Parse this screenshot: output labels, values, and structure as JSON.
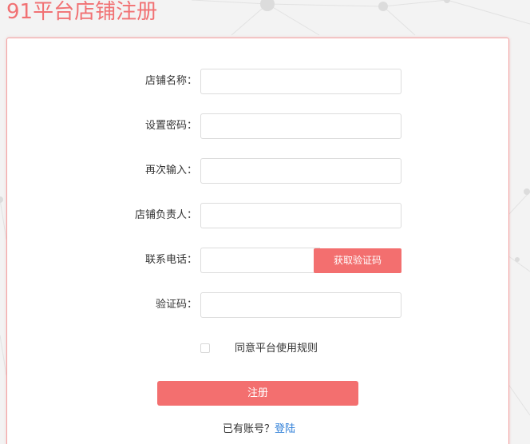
{
  "page": {
    "title": "91平台店铺注册"
  },
  "form": {
    "fields": [
      {
        "label": "店铺名称：",
        "value": "",
        "placeholder": ""
      },
      {
        "label": "设置密码：",
        "value": "",
        "placeholder": ""
      },
      {
        "label": "再次输入：",
        "value": "",
        "placeholder": ""
      },
      {
        "label": "店铺负责人：",
        "value": "",
        "placeholder": ""
      },
      {
        "label": "联系电话：",
        "value": "",
        "placeholder": ""
      },
      {
        "label": "验证码：",
        "value": "",
        "placeholder": ""
      }
    ],
    "sms_button_label": "获取验证码",
    "agree_label": "同意平台使用规则",
    "agree_checked": false,
    "submit_label": "注册",
    "login_prompt": "已有账号？",
    "login_link": "登陆"
  },
  "colors": {
    "accent": "#f36f6f",
    "title": "#f17173",
    "link": "#2f7fd8"
  }
}
